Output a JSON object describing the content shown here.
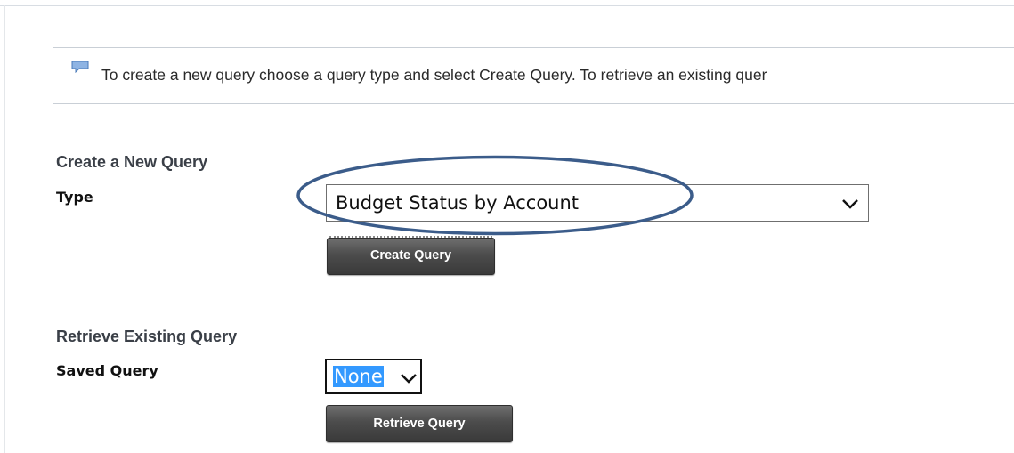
{
  "info": {
    "icon": "speech-bubble-icon",
    "text": "To create a new query choose a query type and select Create Query. To retrieve an existing quer"
  },
  "create_section": {
    "title": "Create a New Query",
    "type_label": "Type",
    "type_value": "Budget Status by Account",
    "button_label": "Create Query"
  },
  "retrieve_section": {
    "title": "Retrieve Existing Query",
    "saved_label": "Saved Query",
    "saved_value": "None",
    "button_label": "Retrieve Query"
  },
  "colors": {
    "annotation_ellipse": "#3b5c8a",
    "selection_highlight": "#3399ff",
    "button_dark": "#4c4c4c",
    "section_title": "#3a3f47"
  }
}
